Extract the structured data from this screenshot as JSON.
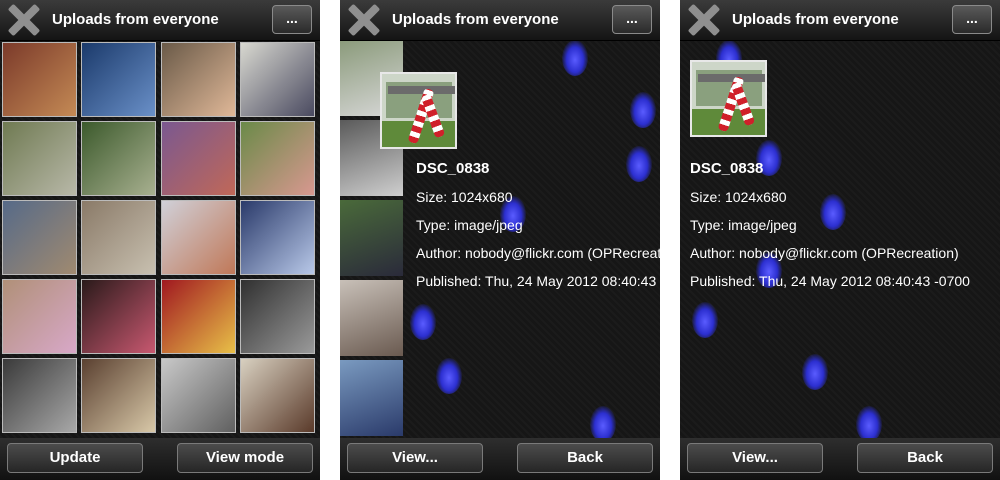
{
  "header": {
    "title": "Uploads from everyone",
    "more_label": "..."
  },
  "grid_view": {
    "footer": {
      "left_label": "Update",
      "right_label": "View mode"
    },
    "thumbnails": [
      {
        "colors": [
          "#7b3a2a",
          "#c48a55"
        ]
      },
      {
        "colors": [
          "#1b3a6b",
          "#6a90c8"
        ]
      },
      {
        "colors": [
          "#6a5a48",
          "#e0b898"
        ]
      },
      {
        "colors": [
          "#d8d8d0",
          "#4a4a60"
        ]
      },
      {
        "colors": [
          "#6f7a52",
          "#b8b8a8"
        ]
      },
      {
        "colors": [
          "#3c5a2c",
          "#a8b090"
        ]
      },
      {
        "colors": [
          "#7a5890",
          "#c06858"
        ]
      },
      {
        "colors": [
          "#6a8a48",
          "#d89890"
        ]
      },
      {
        "colors": [
          "#566a88",
          "#a08a70"
        ]
      },
      {
        "colors": [
          "#8a7a68",
          "#c8c0b0"
        ]
      },
      {
        "colors": [
          "#d0d0d8",
          "#c07858"
        ]
      },
      {
        "colors": [
          "#2a3a6a",
          "#b8c8e8"
        ]
      },
      {
        "colors": [
          "#b09078",
          "#d8a8c8"
        ]
      },
      {
        "colors": [
          "#2a1a1a",
          "#c85870"
        ]
      },
      {
        "colors": [
          "#a01820",
          "#e8c048"
        ]
      },
      {
        "colors": [
          "#303030",
          "#9a9a9a"
        ]
      },
      {
        "colors": [
          "#3a3a3a",
          "#a8a8a8"
        ]
      },
      {
        "colors": [
          "#5a4030",
          "#d8c8a8"
        ]
      },
      {
        "colors": [
          "#c8c8c8",
          "#606060"
        ]
      },
      {
        "colors": [
          "#d8d0c0",
          "#5a3a2a"
        ]
      }
    ]
  },
  "detail_view": {
    "footer": {
      "left_label": "View...",
      "right_label": "Back"
    },
    "file_name": "DSC_0838",
    "size_text": "Size: 1024x680",
    "type_text": "Type: image/jpeg",
    "author_text": "Author: nobody@flickr.com (OPRecreation)",
    "published_text": "Published: Thu, 24 May 2012 08:40:43 -0700",
    "strip_thumbnails": [
      {
        "colors": [
          "#8a9a7a",
          "#d8d8d8"
        ]
      },
      {
        "colors": [
          "#5a5a5a",
          "#cfcfcf"
        ]
      },
      {
        "colors": [
          "#4a6a3a",
          "#2a2a3a"
        ]
      },
      {
        "colors": [
          "#c8c0b8",
          "#6a5a50"
        ]
      },
      {
        "colors": [
          "#7a9ac0",
          "#2a3a6a"
        ]
      }
    ]
  }
}
